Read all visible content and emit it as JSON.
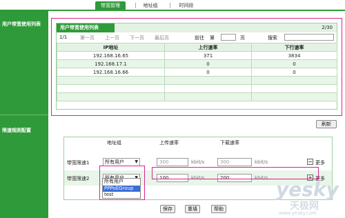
{
  "top_tabs": [
    "带宽管理",
    "地址组",
    "时间段"
  ],
  "sidebar": {
    "user_bw_list": "用户带宽使用列表",
    "rate_limit_rules": "限速规则配置"
  },
  "user_panel": {
    "title": "用户带宽使用列表",
    "page_indicator": "2/30",
    "toolbar": {
      "page": "1/1",
      "first": "第一页",
      "prev": "上一页",
      "next": "下一页",
      "last": "最后页",
      "goto": "前往",
      "di": "第",
      "ye": "页",
      "search": "搜索"
    },
    "columns": [
      "IP地址",
      "上行速率",
      "下行速率"
    ],
    "rows": [
      [
        "192.168.16.65",
        "371",
        "3834"
      ],
      [
        "192.168.17.1",
        "0",
        "0"
      ],
      [
        "192.168.16.66",
        "0",
        "0"
      ],
      [
        "",
        "",
        ""
      ],
      [
        "",
        "",
        ""
      ],
      [
        "",
        "",
        ""
      ]
    ]
  },
  "refresh_label": "刷新",
  "rate_panel": {
    "headers": {
      "group": "地址组",
      "up": "上传速率",
      "down": "下载速率"
    },
    "rule1": {
      "name": "带宽限速1",
      "group": "所有用户",
      "up": "300",
      "down": "300",
      "unit": "kbit/s",
      "more": "更多",
      "more_sign": "−"
    },
    "rule2": {
      "name": "带宽限速2",
      "group": "所有用户",
      "up": "100",
      "down": "200",
      "unit": "kbit/s",
      "more": "更多",
      "more_sign": "+"
    },
    "dropdown_options": [
      "所有用户",
      "PPPoEGroup",
      "test"
    ],
    "dropdown_highlighted": 1
  },
  "buttons": {
    "save": "保存",
    "reset": "重填",
    "help": "帮助"
  },
  "watermark": {
    "big": "yesky",
    "cn": "天极网",
    "url": "www.yesky.com"
  },
  "colors": {
    "accent_green": "#2f9a39",
    "highlight_pink": "#d9238b",
    "selection_blue": "#3a6fd6"
  }
}
